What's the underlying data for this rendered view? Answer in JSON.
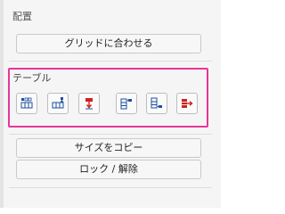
{
  "sections": {
    "placement": {
      "title": "配置",
      "align_grid_label": "グリッドに合わせる"
    },
    "table": {
      "title": "テーブル",
      "buttons": [
        {
          "icon": "table-row-add-below-icon"
        },
        {
          "icon": "table-row-add-below-right-icon"
        },
        {
          "icon": "table-row-delete-icon"
        },
        {
          "icon": "table-column-add-left-icon"
        },
        {
          "icon": "table-column-add-right-icon"
        },
        {
          "icon": "table-column-delete-icon"
        }
      ]
    },
    "misc": {
      "copy_size_label": "サイズをコピー",
      "lock_label": "ロック / 解除"
    }
  },
  "colors": {
    "highlight": "#e6369a",
    "icon_blue": "#1f4f9e",
    "icon_red": "#cc2222"
  }
}
